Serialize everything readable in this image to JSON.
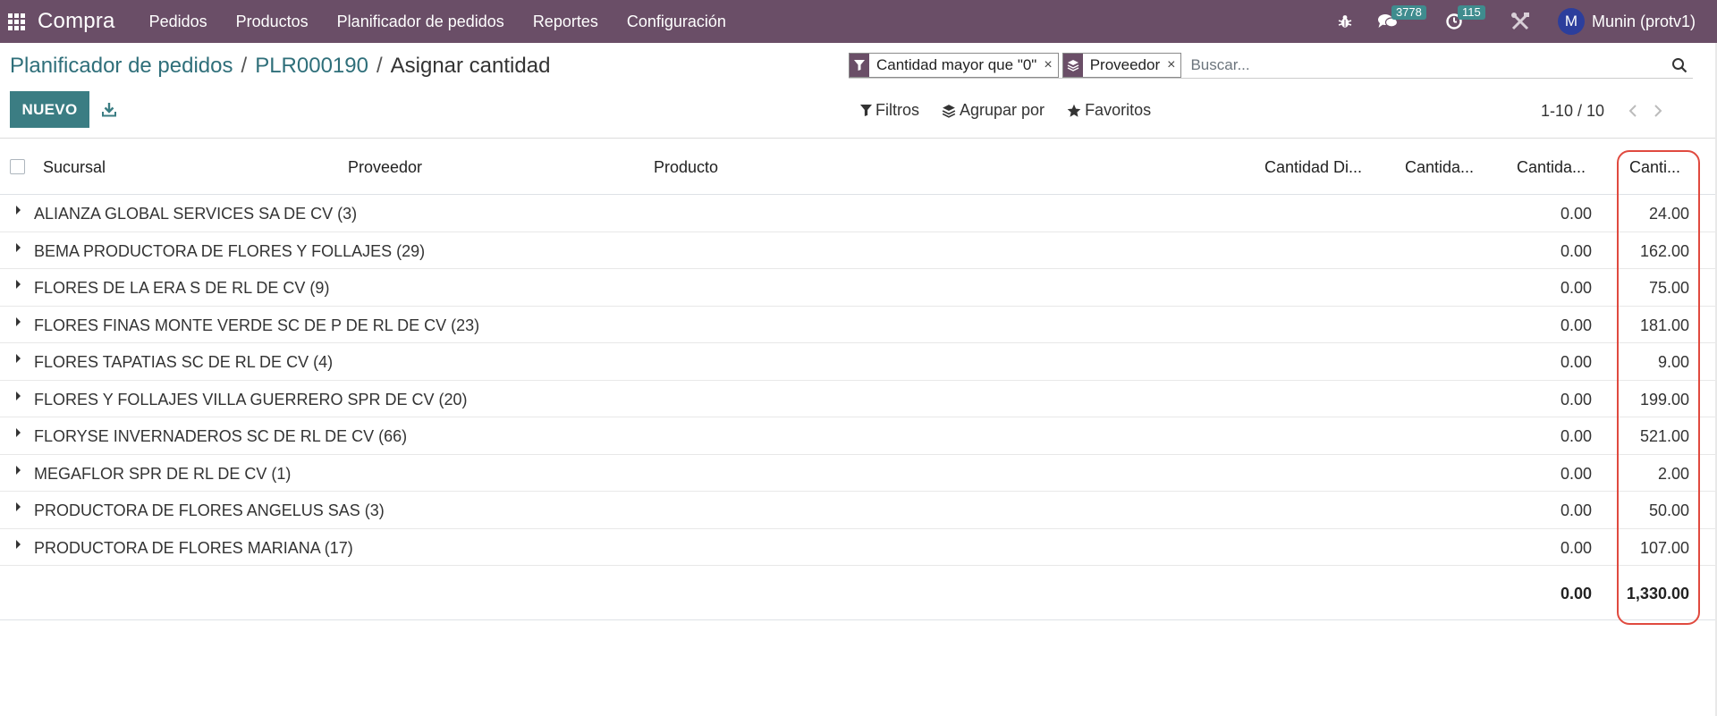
{
  "navbar": {
    "app_name": "Compra",
    "menu": [
      "Pedidos",
      "Productos",
      "Planificador de pedidos",
      "Reportes",
      "Configuración"
    ],
    "messages_count": "3778",
    "activities_count": "115",
    "user_initial": "M",
    "user_name": "Munin (protv1)"
  },
  "breadcrumb": {
    "items": [
      "Planificador de pedidos",
      "PLR000190"
    ],
    "current": "Asignar cantidad",
    "separator": "/"
  },
  "search": {
    "facets": [
      {
        "icon": "filter-icon",
        "label": "Cantidad mayor que \"0\""
      },
      {
        "icon": "layers-icon",
        "label": "Proveedor"
      }
    ],
    "remove_glyph": "×",
    "placeholder": "Buscar..."
  },
  "buttons": {
    "new_label": "NUEVO"
  },
  "search_options": {
    "filters": "Filtros",
    "group_by": "Agrupar por",
    "favorites": "Favoritos"
  },
  "pager": {
    "value": "1-10 / 10"
  },
  "table": {
    "columns": [
      "Sucursal",
      "Proveedor",
      "Producto",
      "Cantidad Di...",
      "Cantida...",
      "Cantida...",
      "Canti..."
    ],
    "groups": [
      {
        "name": "ALIANZA GLOBAL SERVICES SA DE CV (3)",
        "col_a": "0.00",
        "col_b": "24.00"
      },
      {
        "name": "BEMA PRODUCTORA DE FLORES Y FOLLAJES (29)",
        "col_a": "0.00",
        "col_b": "162.00"
      },
      {
        "name": "FLORES DE LA ERA S DE RL DE CV (9)",
        "col_a": "0.00",
        "col_b": "75.00"
      },
      {
        "name": "FLORES FINAS MONTE VERDE SC DE P DE RL DE CV (23)",
        "col_a": "0.00",
        "col_b": "181.00"
      },
      {
        "name": "FLORES TAPATIAS SC DE RL DE CV (4)",
        "col_a": "0.00",
        "col_b": "9.00"
      },
      {
        "name": "FLORES Y FOLLAJES VILLA GUERRERO SPR DE CV (20)",
        "col_a": "0.00",
        "col_b": "199.00"
      },
      {
        "name": "FLORYSE INVERNADEROS SC DE RL DE CV (66)",
        "col_a": "0.00",
        "col_b": "521.00"
      },
      {
        "name": "MEGAFLOR SPR DE RL DE CV (1)",
        "col_a": "0.00",
        "col_b": "2.00"
      },
      {
        "name": "PRODUCTORA DE FLORES ANGELUS SAS (3)",
        "col_a": "0.00",
        "col_b": "50.00"
      },
      {
        "name": "PRODUCTORA DE FLORES MARIANA (17)",
        "col_a": "0.00",
        "col_b": "107.00"
      }
    ],
    "totals": {
      "col_a": "0.00",
      "col_b": "1,330.00"
    }
  },
  "colors": {
    "navbar": "#6a4e67",
    "primary_button": "#3b7d83",
    "link": "#2f6f7a",
    "badge": "#3f8c8e",
    "highlight": "#e04a3f"
  }
}
